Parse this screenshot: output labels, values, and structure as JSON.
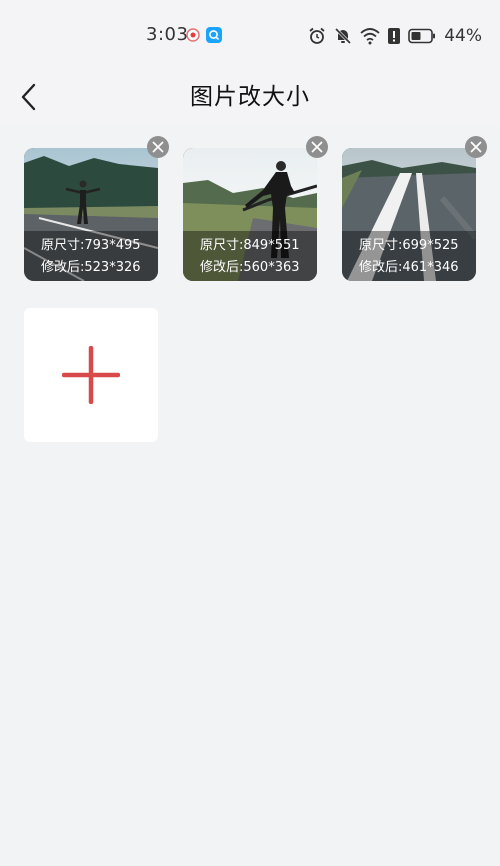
{
  "status_bar": {
    "time": "3:03",
    "battery_percent": "44%",
    "icons": [
      "record-icon",
      "search-app-icon",
      "alarm-icon",
      "mute-icon",
      "wifi-icon",
      "alert-icon",
      "battery-icon"
    ]
  },
  "header": {
    "title": "图片改大小",
    "back_icon": "back-chevron-icon"
  },
  "images": [
    {
      "original_size": "原尺寸:793*495",
      "new_size": "修改后:523*326"
    },
    {
      "original_size": "原尺寸:849*551",
      "new_size": "修改后:560*363"
    },
    {
      "original_size": "原尺寸:699*525",
      "new_size": "修改后:461*346"
    }
  ],
  "add_button": {
    "icon": "plus-icon",
    "color": "#d84a4a"
  },
  "colors": {
    "background": "#f2f3f5",
    "accent": "#d84a4a",
    "close_badge": "#8f8f8f"
  }
}
